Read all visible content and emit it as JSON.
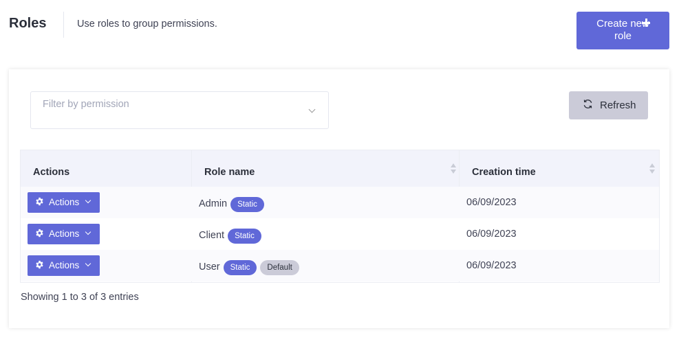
{
  "header": {
    "title": "Roles",
    "description": "Use roles to group permissions.",
    "create_button": "Create new role"
  },
  "filter": {
    "placeholder": "Filter by permission"
  },
  "toolbar": {
    "refresh_label": "Refresh"
  },
  "table": {
    "columns": [
      "Actions",
      "Role name",
      "Creation time"
    ],
    "rows": [
      {
        "action_label": "Actions",
        "role_name": "Admin",
        "badges": [
          "Static"
        ],
        "creation_time": "06/09/2023"
      },
      {
        "action_label": "Actions",
        "role_name": "Client",
        "badges": [
          "Static"
        ],
        "creation_time": "06/09/2023"
      },
      {
        "action_label": "Actions",
        "role_name": "User",
        "badges": [
          "Static",
          "Default"
        ],
        "creation_time": "06/09/2023"
      }
    ]
  },
  "footer": {
    "entries_text": "Showing 1 to 3 of 3 entries"
  },
  "colors": {
    "primary": "#6068d8",
    "secondary": "#cbcbd8"
  },
  "icons": {
    "create": "plus-icon",
    "refresh": "refresh-icon",
    "actions": "gear-icon",
    "dropdown": "chevron-down-icon",
    "sort": "sort-icon"
  }
}
